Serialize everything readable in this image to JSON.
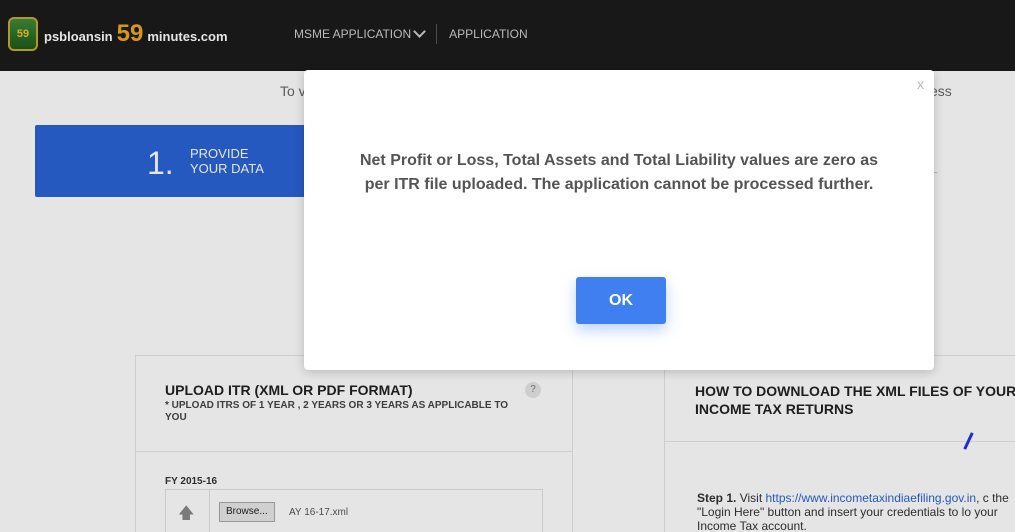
{
  "header": {
    "logo_badge": "59",
    "logo_prefix": "psbloansin",
    "logo_number": "59",
    "logo_suffix": "minutes.com",
    "nav": [
      {
        "label": "MSME APPLICATION",
        "icon": "chevron-down-icon"
      },
      {
        "label": "APPLICATION"
      }
    ]
  },
  "page": {
    "intro_start": "To v",
    "intro_end": "ess",
    "step": {
      "number": "1.",
      "label_line1": "PROVIDE",
      "label_line2": "YOUR DATA"
    },
    "step_right_fragment": "L",
    "upload": {
      "title": "UPLOAD ITR (XML OR PDF FORMAT)",
      "subtitle": "* UPLOAD ITRS OF 1 YEAR , 2 YEARS OR 3 YEARS AS APPLICABLE TO YOU",
      "help": "?",
      "fy_label": "FY 2015-16",
      "browse_label": "Browse...",
      "file_name": "AY 16-17.xml"
    },
    "how_to": {
      "title": "HOW TO DOWNLOAD THE XML FILES OF YOUR INCOME TAX RETURNS",
      "step_label": "Step 1.",
      "step_text_before": "Visit",
      "link_text": "https://www.incometaxindiaefiling.gov.in",
      "step_text_after": ", c the \"Login Here\" button and insert your credentials to lo your Income Tax account."
    }
  },
  "modal": {
    "close_label": "x",
    "message": "Net Profit or Loss, Total Assets and Total Liability values are zero as per ITR file uploaded. The application cannot be processed further.",
    "ok_label": "OK"
  },
  "colors": {
    "accent": "#3f7fef",
    "header_bg": "#1b1b1b",
    "step_card": "#2a64d6"
  }
}
